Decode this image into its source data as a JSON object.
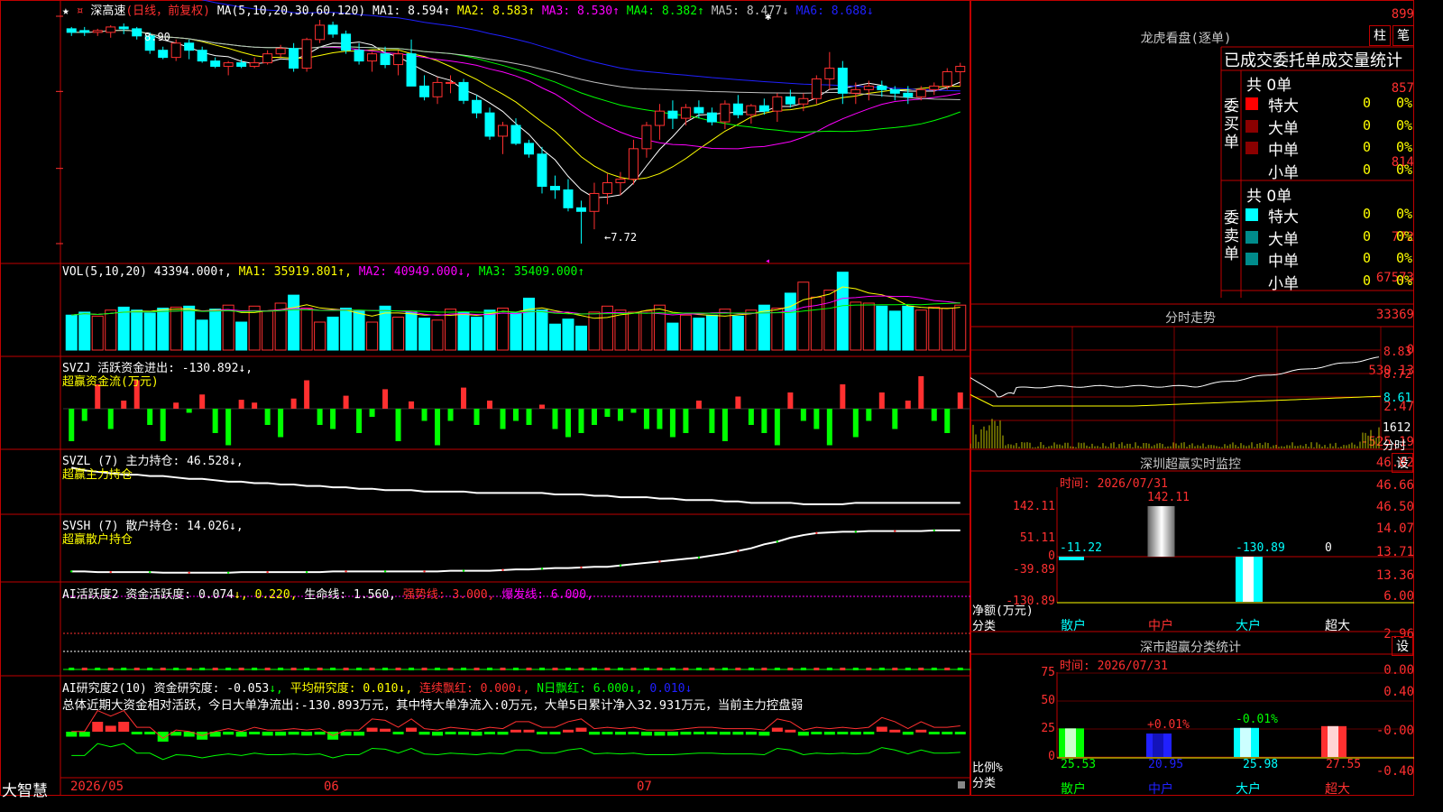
{
  "stock": {
    "name": "深高速",
    "period": "(日线，前复权)",
    "ma_label": "MA(5,10,20,30,60,120)",
    "ma_values": [
      {
        "label": "MA1:",
        "val": "8.594↑",
        "color": "#ffffff"
      },
      {
        "label": "MA2:",
        "val": "8.583↑",
        "color": "#ffff00"
      },
      {
        "label": "MA3:",
        "val": "8.530↑",
        "color": "#ff00ff"
      },
      {
        "label": "MA4:",
        "val": "8.382↑",
        "color": "#00ff00"
      },
      {
        "label": "MA5:",
        "val": "8.477↓",
        "color": "#c0c0c0"
      },
      {
        "label": "MA6:",
        "val": "8.688↓",
        "color": "#2020ff"
      }
    ],
    "y_labels": [
      "899",
      "857",
      "814",
      "772"
    ],
    "high_mark": "8.90",
    "low_mark": "←7.72"
  },
  "volume": {
    "header": "VOL(5,10,20)",
    "val": "43394.000↑,",
    "ma": [
      {
        "label": "MA1:",
        "val": "35919.801↑,",
        "color": "#ffff00"
      },
      {
        "label": "MA2:",
        "val": "40949.000↓,",
        "color": "#ff00ff"
      },
      {
        "label": "MA3:",
        "val": "35409.000↑",
        "color": "#00ff00"
      }
    ],
    "y_labels": [
      "67573",
      "33369",
      "0"
    ]
  },
  "svzj": {
    "header": "SVZJ  活跃资金进出: -130.892↓,",
    "sub": "超赢资金流(万元)",
    "y_labels": [
      "530.13",
      "2.47",
      "-525.19"
    ]
  },
  "svzl": {
    "header": "SVZL (7) 主力持仓: 46.528↓,",
    "sub": "超赢主力持仓",
    "y_labels": [
      "46.82",
      "46.66",
      "46.50"
    ]
  },
  "svsh": {
    "header": "SVSH (7) 散户持仓: 14.026↓,",
    "sub": "超赢散户持仓",
    "y_labels": [
      "14.07",
      "13.71",
      "13.36"
    ]
  },
  "ai_active": {
    "h1": "AI活跃度2 资金活跃度: 0.074",
    "h2": "↓, 0.220,",
    "h3": " 生命线: 1.560,",
    "h4": " 强势线: 3.000,",
    "h5": " 爆发线: 6.000,",
    "y_labels": [
      "6.00",
      "2.96",
      "0.00"
    ]
  },
  "ai_research": {
    "h1": "AI研究度2(10) 资金研究度: -0.053",
    "h2": "↓,",
    "h3": " 平均研究度: 0.010↓,",
    "h4": " 连续飘红: 0.000↓,",
    "h5": " N日飘红: 6.000↓,",
    "h6": " 0.010↓",
    "summary": "总体近期大资金相对活跃，今日大单净流出:-130.893万元，其中特大单净流入:0万元，大单5日累计净入32.931万元，当前主力控盘弱",
    "y_labels": [
      "0.40",
      "-0.00",
      "-0.40"
    ]
  },
  "footer": {
    "logo": "大智慧",
    "dates": [
      "2026/05",
      "06",
      "07"
    ]
  },
  "dragon_tiger": {
    "title": "龙虎看盘(逐单)",
    "btn1": "柱",
    "btn2": "笔",
    "tabs": "已成交委托单成交量统计",
    "buy_label": "委买单",
    "sell_label": "委卖单",
    "buy_total": "共 0单",
    "sell_total": "共 0单",
    "rows": [
      "特大",
      "大单",
      "中单",
      "小单"
    ],
    "vals": [
      "0",
      "0",
      "0",
      "0"
    ],
    "pcts": [
      "0%",
      "0%",
      "0%",
      "0%"
    ]
  },
  "intraday": {
    "title": "分时走势",
    "y_labels": [
      "8.83",
      "8.72",
      "8.61"
    ],
    "vol_label": "1612",
    "vol_unit": "分时"
  },
  "monitor": {
    "title": "深圳超赢实时监控",
    "set": "设",
    "time": "时间: 2026/07/31",
    "y_labels": [
      "142.11",
      "51.11",
      "0",
      "-39.89",
      "-130.89"
    ],
    "bar_labels": [
      "-11.22",
      "142.11",
      "-130.89",
      "0"
    ],
    "unit1": "净额(万元)",
    "unit2": "分类",
    "cats": [
      "散户",
      "中户",
      "大户",
      "超大"
    ]
  },
  "classify": {
    "title": "深市超赢分类统计",
    "set": "设",
    "time": "时间: 2026/07/31",
    "y_labels": [
      "75",
      "50",
      "25",
      "0"
    ],
    "top_labels": [
      "+0.01%",
      "-0.01%"
    ],
    "values": [
      "25.53",
      "20.95",
      "25.98",
      "27.55"
    ],
    "unit1": "比例%",
    "unit2": "分类",
    "cats": [
      "散户",
      "中户",
      "大户",
      "超大"
    ]
  },
  "chart_data": {
    "type": "candlestick",
    "ylim": [
      7.72,
      8.99
    ],
    "candles": [
      [
        8.92,
        8.93,
        8.88,
        8.9
      ],
      [
        8.91,
        8.93,
        8.88,
        8.9
      ],
      [
        8.9,
        8.92,
        8.88,
        8.91
      ],
      [
        8.9,
        8.94,
        8.87,
        8.93
      ],
      [
        8.93,
        8.95,
        8.89,
        8.92
      ],
      [
        8.92,
        8.93,
        8.86,
        8.88
      ],
      [
        8.88,
        8.9,
        8.78,
        8.8
      ],
      [
        8.8,
        8.82,
        8.75,
        8.76
      ],
      [
        8.76,
        8.86,
        8.74,
        8.84
      ],
      [
        8.84,
        8.86,
        8.75,
        8.8
      ],
      [
        8.8,
        8.82,
        8.73,
        8.74
      ],
      [
        8.74,
        8.76,
        8.7,
        8.71
      ],
      [
        8.71,
        8.74,
        8.66,
        8.73
      ],
      [
        8.73,
        8.75,
        8.7,
        8.71
      ],
      [
        8.71,
        8.76,
        8.7,
        8.73
      ],
      [
        8.73,
        8.8,
        8.72,
        8.78
      ],
      [
        8.78,
        8.83,
        8.76,
        8.81
      ],
      [
        8.81,
        8.84,
        8.68,
        8.7
      ],
      [
        8.7,
        8.87,
        8.68,
        8.86
      ],
      [
        8.86,
        8.97,
        8.84,
        8.94
      ],
      [
        8.94,
        8.96,
        8.87,
        8.89
      ],
      [
        8.89,
        8.91,
        8.78,
        8.8
      ],
      [
        8.8,
        8.84,
        8.72,
        8.74
      ],
      [
        8.74,
        8.79,
        8.68,
        8.78
      ],
      [
        8.78,
        8.82,
        8.7,
        8.72
      ],
      [
        8.72,
        8.8,
        8.66,
        8.78
      ],
      [
        8.78,
        8.86,
        8.7,
        8.6
      ],
      [
        8.6,
        8.66,
        8.52,
        8.54
      ],
      [
        8.54,
        8.65,
        8.5,
        8.62
      ],
      [
        8.62,
        8.66,
        8.56,
        8.62
      ],
      [
        8.62,
        8.64,
        8.5,
        8.52
      ],
      [
        8.52,
        8.55,
        8.42,
        8.45
      ],
      [
        8.45,
        8.48,
        8.3,
        8.32
      ],
      [
        8.32,
        8.4,
        8.22,
        8.38
      ],
      [
        8.38,
        8.42,
        8.27,
        8.28
      ],
      [
        8.28,
        8.3,
        8.2,
        8.22
      ],
      [
        8.22,
        8.26,
        8.0,
        8.04
      ],
      [
        8.04,
        8.1,
        7.97,
        8.02
      ],
      [
        8.02,
        8.08,
        7.9,
        7.92
      ],
      [
        7.92,
        7.96,
        7.72,
        7.9
      ],
      [
        7.9,
        8.06,
        7.8,
        8.0
      ],
      [
        8.0,
        8.11,
        7.94,
        8.06
      ],
      [
        8.06,
        8.12,
        7.99,
        8.08
      ],
      [
        8.08,
        8.3,
        8.05,
        8.25
      ],
      [
        8.25,
        8.4,
        8.2,
        8.38
      ],
      [
        8.38,
        8.5,
        8.3,
        8.46
      ],
      [
        8.46,
        8.52,
        8.36,
        8.42
      ],
      [
        8.42,
        8.5,
        8.38,
        8.48
      ],
      [
        8.48,
        8.52,
        8.42,
        8.45
      ],
      [
        8.45,
        8.48,
        8.38,
        8.4
      ],
      [
        8.4,
        8.52,
        8.36,
        8.5
      ],
      [
        8.5,
        8.55,
        8.42,
        8.44
      ],
      [
        8.44,
        8.5,
        8.39,
        8.49
      ],
      [
        8.49,
        8.53,
        8.44,
        8.46
      ],
      [
        8.46,
        8.56,
        8.4,
        8.54
      ],
      [
        8.54,
        8.58,
        8.48,
        8.5
      ],
      [
        8.5,
        8.56,
        8.46,
        8.53
      ],
      [
        8.53,
        8.66,
        8.5,
        8.64
      ],
      [
        8.64,
        8.79,
        8.58,
        8.7
      ],
      [
        8.7,
        8.74,
        8.5,
        8.56
      ],
      [
        8.56,
        8.62,
        8.5,
        8.58
      ],
      [
        8.58,
        8.63,
        8.52,
        8.6
      ],
      [
        8.6,
        8.63,
        8.54,
        8.58
      ],
      [
        8.58,
        8.6,
        8.52,
        8.56
      ],
      [
        8.56,
        8.6,
        8.5,
        8.54
      ],
      [
        8.54,
        8.6,
        8.52,
        8.58
      ],
      [
        8.58,
        8.62,
        8.55,
        8.6
      ],
      [
        8.6,
        8.7,
        8.58,
        8.68
      ],
      [
        8.68,
        8.73,
        8.6,
        8.71
      ]
    ],
    "volume": [
      35,
      38,
      34,
      40,
      43,
      40,
      37,
      42,
      43,
      44,
      30,
      41,
      45,
      28,
      44,
      39,
      47,
      55,
      42,
      28,
      33,
      42,
      39,
      28,
      44,
      33,
      38,
      32,
      30,
      41,
      38,
      33,
      40,
      42,
      37,
      52,
      40,
      26,
      31,
      24,
      38,
      44,
      40,
      38,
      39,
      45,
      27,
      35,
      32,
      35,
      41,
      34,
      40,
      45,
      42,
      57,
      68,
      53,
      60,
      78,
      48,
      47,
      44,
      39,
      44,
      40,
      43,
      42,
      45
    ],
    "flow": [
      -80,
      -30,
      60,
      -50,
      20,
      70,
      -40,
      -80,
      15,
      -10,
      35,
      -60,
      -90,
      22,
      15,
      -40,
      -70,
      25,
      70,
      -40,
      -50,
      32,
      -60,
      -20,
      48,
      -80,
      18,
      -30,
      -90,
      -30,
      52,
      -40,
      20,
      -50,
      -30,
      -40,
      10,
      -50,
      -70,
      -60,
      -40,
      -20,
      -30,
      -10,
      -50,
      -50,
      -70,
      -60,
      20,
      -60,
      -80,
      30,
      -40,
      -60,
      -90,
      40,
      -30,
      -50,
      -90,
      60,
      -70,
      -30,
      40,
      -50,
      20,
      80,
      -30,
      -60,
      40
    ],
    "zl": [
      46.78,
      46.76,
      46.75,
      46.74,
      46.73,
      46.73,
      46.72,
      46.72,
      46.71,
      46.7,
      46.7,
      46.69,
      46.68,
      46.68,
      46.67,
      46.67,
      46.66,
      46.66,
      46.65,
      46.65,
      46.64,
      46.64,
      46.63,
      46.63,
      46.62,
      46.62,
      46.62,
      46.61,
      46.61,
      46.61,
      46.61,
      46.6,
      46.6,
      46.6,
      46.6,
      46.6,
      46.6,
      46.59,
      46.59,
      46.59,
      46.58,
      46.58,
      46.57,
      46.57,
      46.57,
      46.56,
      46.56,
      46.55,
      46.55,
      46.55,
      46.54,
      46.54,
      46.53,
      46.53,
      46.53,
      46.53,
      46.52,
      46.52,
      46.52,
      46.52,
      46.53,
      46.53,
      46.53,
      46.53,
      46.53,
      46.53,
      46.53,
      46.53,
      46.53
    ],
    "sh": [
      13.41,
      13.41,
      13.4,
      13.4,
      13.4,
      13.4,
      13.4,
      13.39,
      13.39,
      13.39,
      13.39,
      13.39,
      13.39,
      13.4,
      13.4,
      13.4,
      13.4,
      13.4,
      13.4,
      13.4,
      13.41,
      13.41,
      13.41,
      13.41,
      13.41,
      13.41,
      13.41,
      13.41,
      13.41,
      13.42,
      13.42,
      13.42,
      13.42,
      13.43,
      13.44,
      13.44,
      13.45,
      13.46,
      13.46,
      13.47,
      13.48,
      13.48,
      13.5,
      13.52,
      13.54,
      13.56,
      13.58,
      13.6,
      13.62,
      13.65,
      13.68,
      13.72,
      13.76,
      13.82,
      13.86,
      13.92,
      13.96,
      13.99,
      14.0,
      14.01,
      14.01,
      14.02,
      14.02,
      14.02,
      14.02,
      14.02,
      14.03,
      14.03,
      14.03
    ],
    "research": [
      -0.05,
      -0.05,
      0.1,
      0.06,
      0.1,
      -0.02,
      -0.02,
      -0.1,
      -0.04,
      -0.05,
      -0.08,
      -0.05,
      -0.03,
      -0.05,
      -0.02,
      -0.04,
      -0.04,
      -0.03,
      -0.04,
      -0.03,
      -0.08,
      -0.04,
      -0.04,
      0.04,
      0.03,
      -0.02,
      0.04,
      -0.03,
      -0.04,
      -0.02,
      -0.03,
      -0.04,
      -0.02,
      -0.03,
      0.02,
      0.02,
      -0.02,
      -0.02,
      0.02,
      0.04,
      -0.03,
      -0.02,
      -0.03,
      -0.02,
      -0.04,
      -0.04,
      -0.04,
      -0.03,
      -0.02,
      -0.02,
      -0.03,
      -0.03,
      -0.03,
      -0.04,
      0.04,
      0.02,
      -0.04,
      -0.02,
      -0.03,
      -0.02,
      -0.03,
      -0.02,
      0.05,
      0.02,
      -0.03,
      0.02,
      -0.02,
      -0.02,
      -0.01
    ]
  }
}
